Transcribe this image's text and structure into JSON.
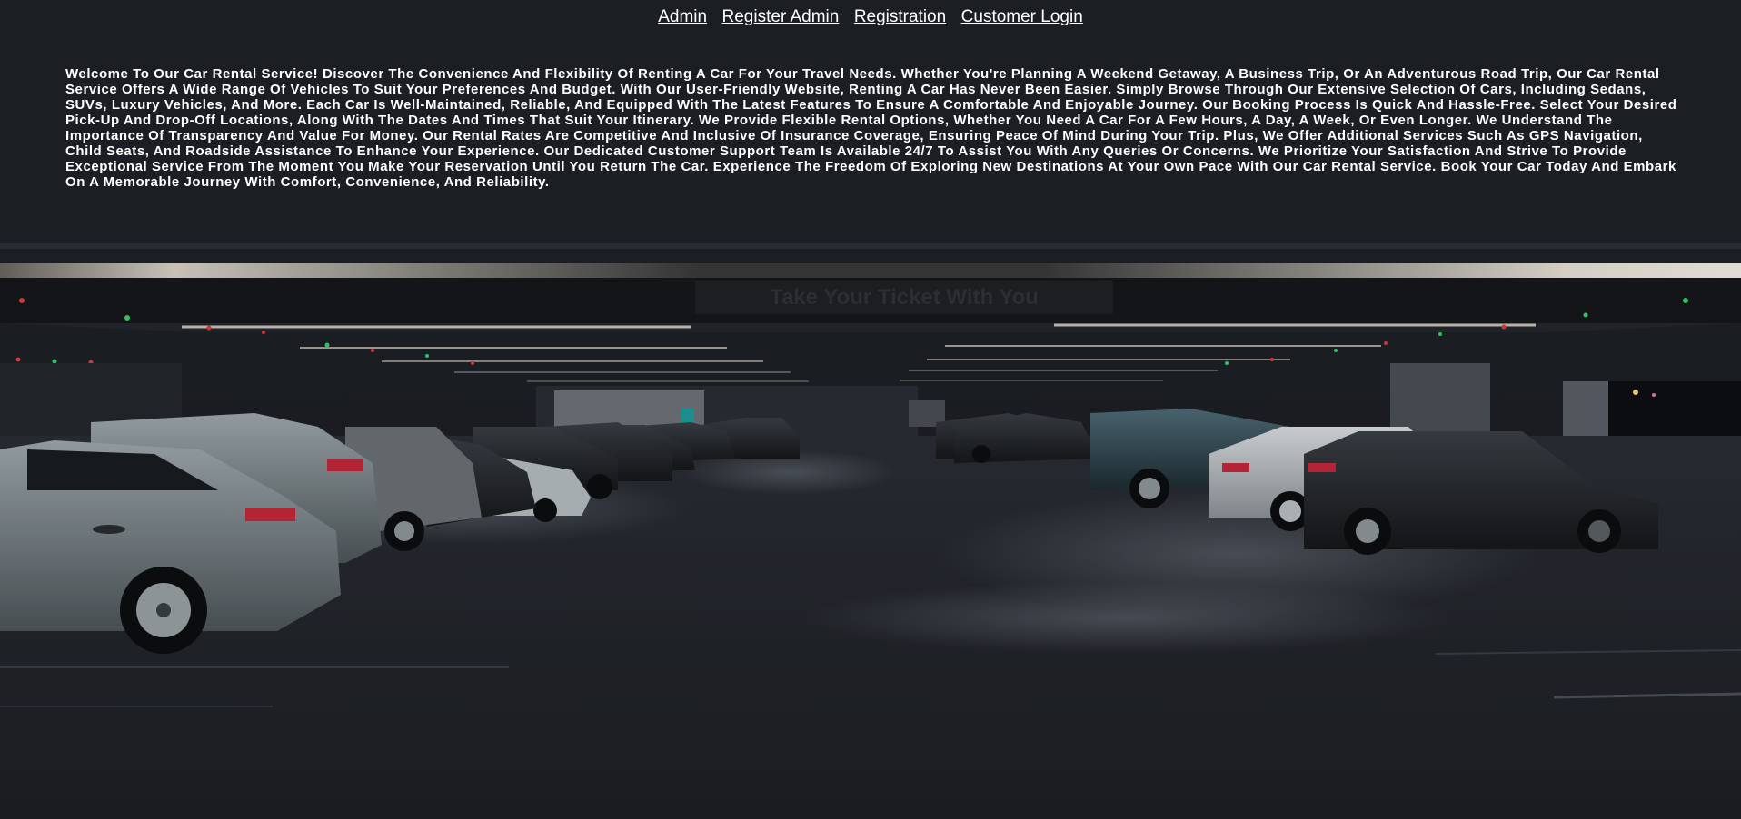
{
  "nav": {
    "links": [
      "Admin",
      "Register Admin",
      "Registration",
      "Customer Login"
    ]
  },
  "intro": {
    "text": "Welcome to our car rental service! Discover the convenience and flexibility of renting a car for your travel needs. Whether you're planning a weekend getaway, a business trip, or an adventurous road trip, our car rental service offers a wide range of vehicles to suit your preferences and budget. With our user-friendly website, renting a car has never been easier. Simply browse through our extensive selection of cars, including sedans, SUVs, luxury vehicles, and more. Each car is well-maintained, reliable, and equipped with the latest features to ensure a comfortable and enjoyable journey. Our booking process is quick and hassle-free. Select your desired pick-up and drop-off locations, along with the dates and times that suit your itinerary. We provide flexible rental options, whether you need a car for a few hours, a day, a week, or even longer. We understand the importance of transparency and value for money. Our rental rates are competitive and inclusive of insurance coverage, ensuring peace of mind during your trip. Plus, we offer additional services such as GPS navigation, child seats, and roadside assistance to enhance your experience. Our dedicated customer support team is available 24/7 to assist you with any queries or concerns. We prioritize your satisfaction and strive to provide exceptional service from the moment you make your reservation until you return the car. Experience the freedom of exploring new destinations at your own pace with our car rental service. Book your car today and embark on a memorable journey with comfort, convenience, and reliability."
  },
  "background": {
    "sign_text": "Take Your Ticket With You"
  },
  "colors": {
    "text": "#ffffff",
    "background": "#1b1d22"
  }
}
